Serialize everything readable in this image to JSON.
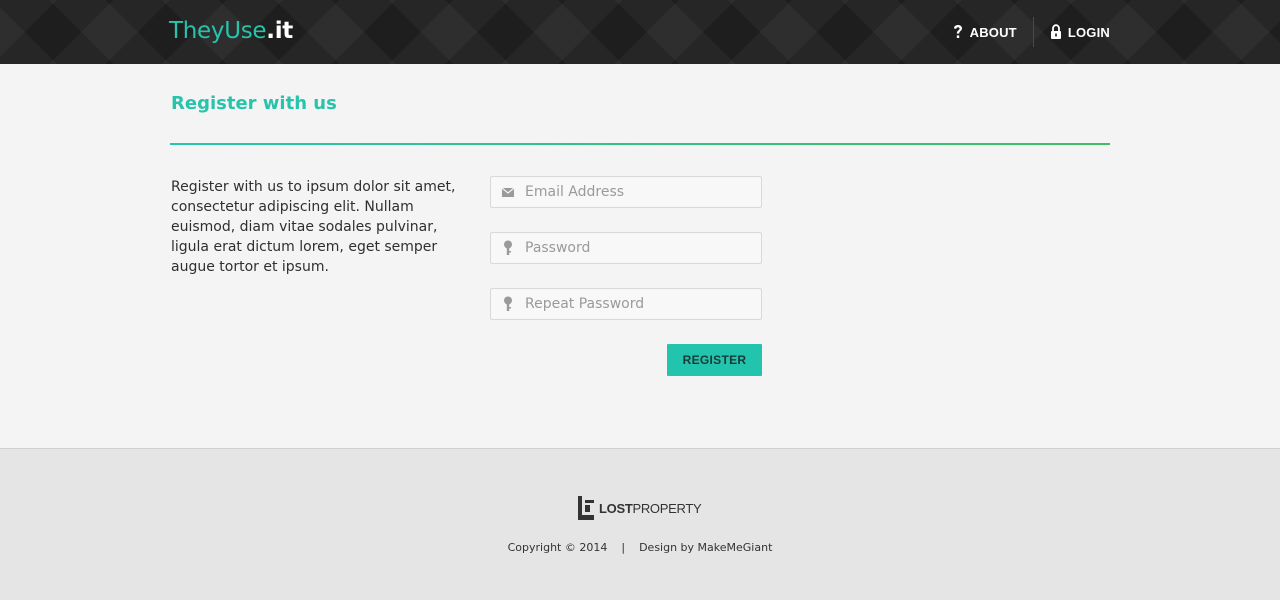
{
  "header": {
    "logo_main": "TheyUse",
    "logo_ext": ".it",
    "nav": {
      "about_label": "ABOUT",
      "about_icon": "question-icon",
      "login_label": "LOGIN",
      "login_icon": "lock-icon"
    }
  },
  "main": {
    "title": "Register with us",
    "intro": "Register with us to ipsum dolor sit amet, consectetur adipiscing elit. Nullam euismod, diam vitae sodales pulvinar, ligula erat dictum lorem, eget semper augue tortor et ipsum.",
    "form": {
      "email": {
        "placeholder": "Email Address",
        "value": "",
        "icon": "envelope-icon"
      },
      "password": {
        "placeholder": "Password",
        "value": "",
        "icon": "key-icon"
      },
      "repeat_password": {
        "placeholder": "Repeat Password",
        "value": "",
        "icon": "key-icon"
      },
      "submit_label": "REGISTER"
    }
  },
  "footer": {
    "brand_bold": "LOST",
    "brand_light": "PROPERTY",
    "copyright": "Copyright © 2014",
    "separator": "|",
    "credit": "Design by MakeMeGiant"
  },
  "colors": {
    "accent": "#27c4ab",
    "button": "#22c4ad",
    "header_bg": "#1e1e1e",
    "page_bg": "#f4f4f4",
    "footer_bg": "#e5e5e5"
  }
}
